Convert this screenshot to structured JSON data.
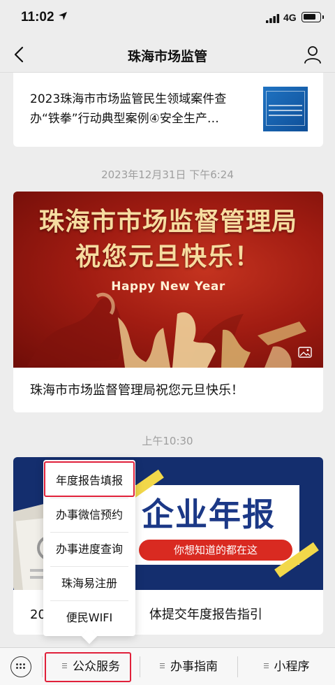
{
  "status": {
    "time": "11:02",
    "network": "4G"
  },
  "nav": {
    "title": "珠海市场监管"
  },
  "articles": [
    {
      "title": "2023珠海市市场监管民生领域案件查办“铁拳”行动典型案例④安全生产…"
    },
    {
      "timestamp": "2023年12月31日 下午6:24",
      "banner_line1": "珠海市市场监督管理局",
      "banner_line2": "祝您元旦快乐！",
      "banner_line3": "Happy New Year",
      "title": "珠海市市场监督管理局祝您元旦快乐！"
    },
    {
      "timestamp": "上午10:30",
      "banner_title": "企业年报",
      "banner_ribbon": "你想知道的都在这",
      "title_visible": "20",
      "title_tail": "体提交年度报告指引"
    }
  ],
  "popup_menu": {
    "items": [
      "年度报告填报",
      "办事微信预约",
      "办事进度查询",
      "珠海易注册",
      "便民WIFI"
    ],
    "highlighted": "年度报告填报"
  },
  "bottom_menu": {
    "items": [
      "公众服务",
      "办事指南",
      "小程序"
    ],
    "active": "公众服务"
  },
  "colors": {
    "highlight": "#e0203a",
    "banner_red": "#a11c12",
    "banner_navy": "#142e6e"
  }
}
